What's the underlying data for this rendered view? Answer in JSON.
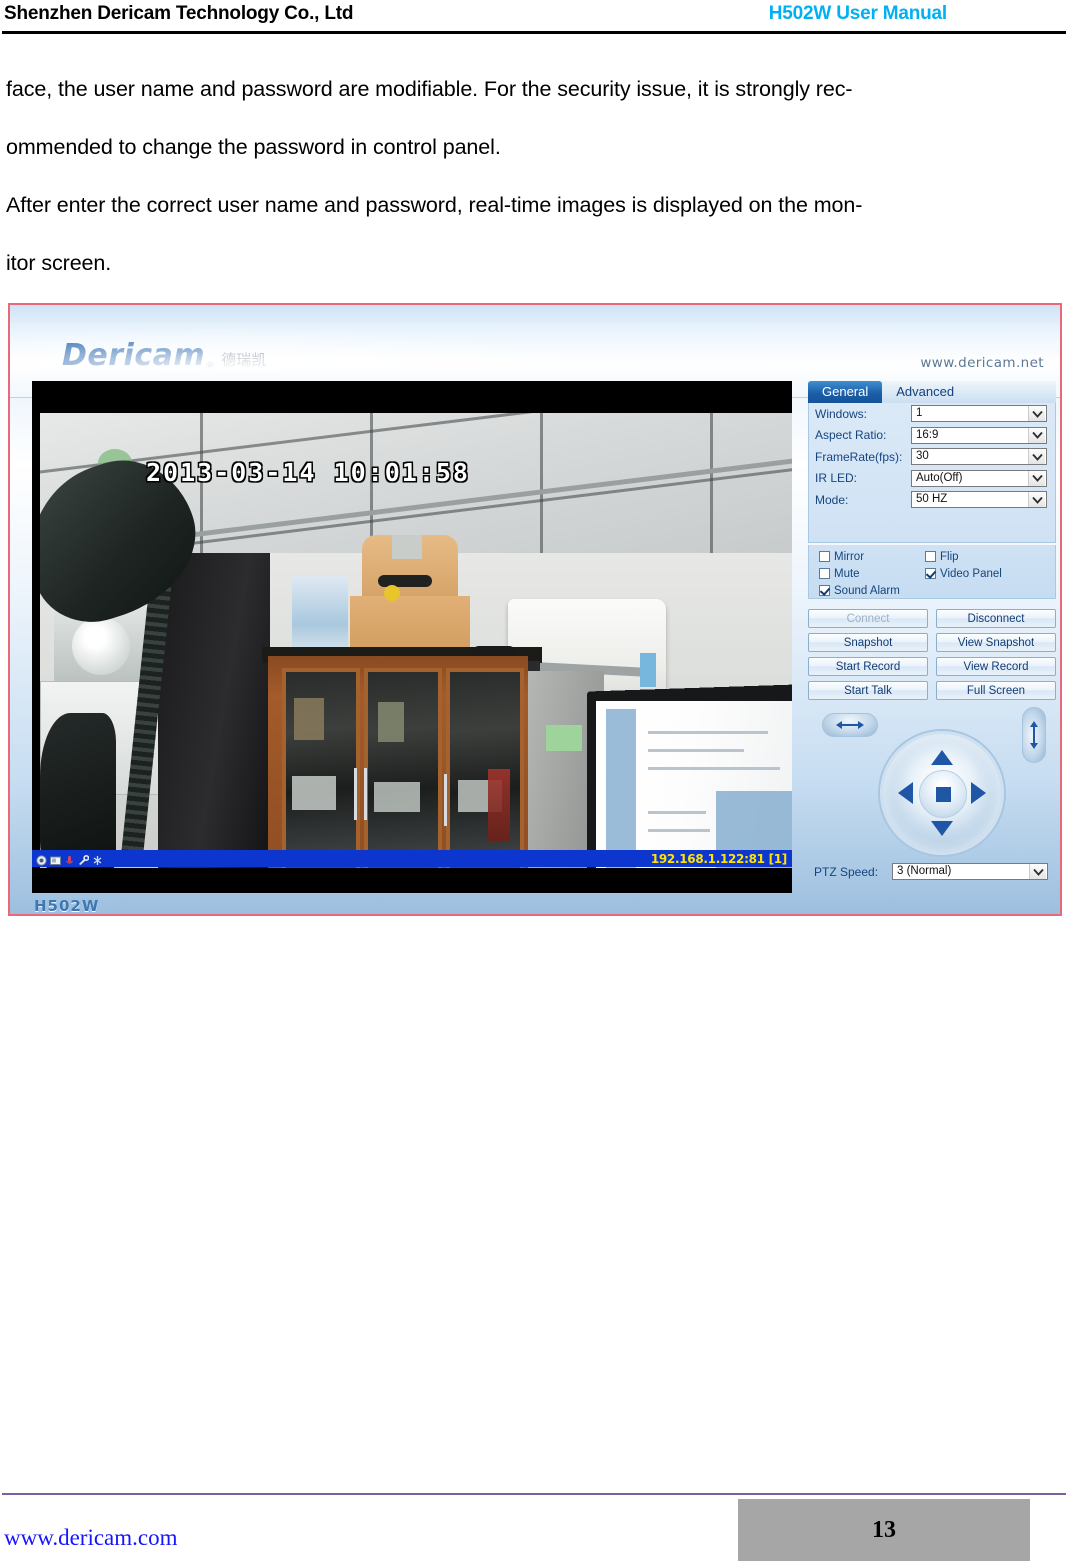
{
  "document": {
    "header": {
      "company": "Shenzhen Dericam Technology Co., Ltd",
      "manual_title": "H502W User Manual",
      "title_color": "#00b0f0"
    },
    "body_lines": [
      "face, the user name and password are modifiable. For the security issue, it is strongly rec-",
      "ommended to change the password in control panel.",
      "After enter the correct user name and password, real-time images is displayed on the mon-",
      "itor screen."
    ],
    "footer": {
      "website": "www.dericam.com",
      "page_number": "13",
      "url_color": "#1414ff",
      "rule_color": "#7c5f9e",
      "page_box_color": "#a6a6a6"
    }
  },
  "screenshot": {
    "border_color": "#e86a78",
    "brand": {
      "logo_text": "Dericam",
      "logo_tm": "®",
      "logo_chinese": "德瑞凯",
      "logo_color": "#1558a8",
      "website": "www.dericam.net"
    },
    "video": {
      "timestamp": "2013-03-14  10:01:58",
      "status_ip": "192.168.1.122:81 [1]",
      "status_bar_color": "#0d36cf",
      "status_text_color": "#ffe400",
      "model_label": "H502W",
      "status_icons": [
        "record-icon",
        "snapshot-icon",
        "audio-icon",
        "talk-icon",
        "alarm-icon"
      ]
    },
    "panel": {
      "tabs": [
        {
          "label": "General",
          "active": true
        },
        {
          "label": "Advanced",
          "active": false
        }
      ],
      "fields": [
        {
          "label": "Windows:",
          "value": "1"
        },
        {
          "label": "Aspect Ratio:",
          "value": "16:9"
        },
        {
          "label": "FrameRate(fps):",
          "value": "30"
        },
        {
          "label": "IR LED:",
          "value": "Auto(Off)"
        },
        {
          "label": "Mode:",
          "value": "50 HZ"
        }
      ],
      "checkboxes": [
        {
          "label": "Mirror",
          "checked": false
        },
        {
          "label": "Flip",
          "checked": false
        },
        {
          "label": "Mute",
          "checked": false
        },
        {
          "label": "Video Panel",
          "checked": true
        },
        {
          "label": "Sound Alarm",
          "checked": true
        }
      ],
      "buttons": [
        {
          "label": "Connect",
          "disabled": true
        },
        {
          "label": "Disconnect",
          "disabled": false
        },
        {
          "label": "Snapshot",
          "disabled": false
        },
        {
          "label": "View Snapshot",
          "disabled": false
        },
        {
          "label": "Start Record",
          "disabled": false
        },
        {
          "label": "View Record",
          "disabled": false
        },
        {
          "label": "Start Talk",
          "disabled": false
        },
        {
          "label": "Full Screen",
          "disabled": false
        }
      ],
      "ptz": {
        "horizontal_scan": "horizontal-scan-icon",
        "vertical_scan": "vertical-scan-icon",
        "up": "arrow-up-icon",
        "down": "arrow-down-icon",
        "left": "arrow-left-icon",
        "right": "arrow-right-icon",
        "stop": "stop-icon",
        "speed_label": "PTZ Speed:",
        "speed_value": "3 (Normal)"
      }
    }
  }
}
